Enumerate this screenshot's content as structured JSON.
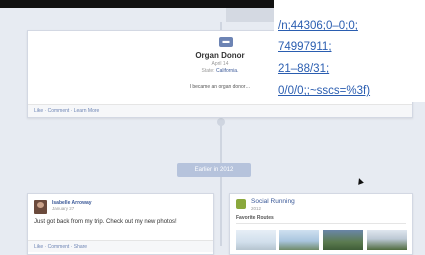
{
  "organ_donor_event": {
    "icon": "life-event-icon",
    "icon_label": "▬",
    "title": "Organ Donor",
    "date": "April 14",
    "state_prefix": "State:",
    "state_value": "California.",
    "text": "I became an organ donor…",
    "actions": "Like · Comment · Learn More"
  },
  "url_overlay": {
    "lines": [
      "/n;44306;0–0;0;",
      "74997911;",
      "21–88/31;",
      "0/0/0;;~sscs=%3f)"
    ]
  },
  "timeline": {
    "earlier_label": "Earlier in 2012"
  },
  "status_post": {
    "author": "Isabelle Arroway",
    "date": "January 27",
    "text": "Just got back from my trip. Check out my new photos!",
    "actions": "Like · Comment · Share"
  },
  "social_running": {
    "icon": "running-app-icon",
    "title": "Social Running",
    "year": "2012",
    "routes_label": "Favorite Routes"
  },
  "colors": {
    "background": "#e7ebf2",
    "link": "#3b5998",
    "overlay_link": "#2a5db0"
  }
}
